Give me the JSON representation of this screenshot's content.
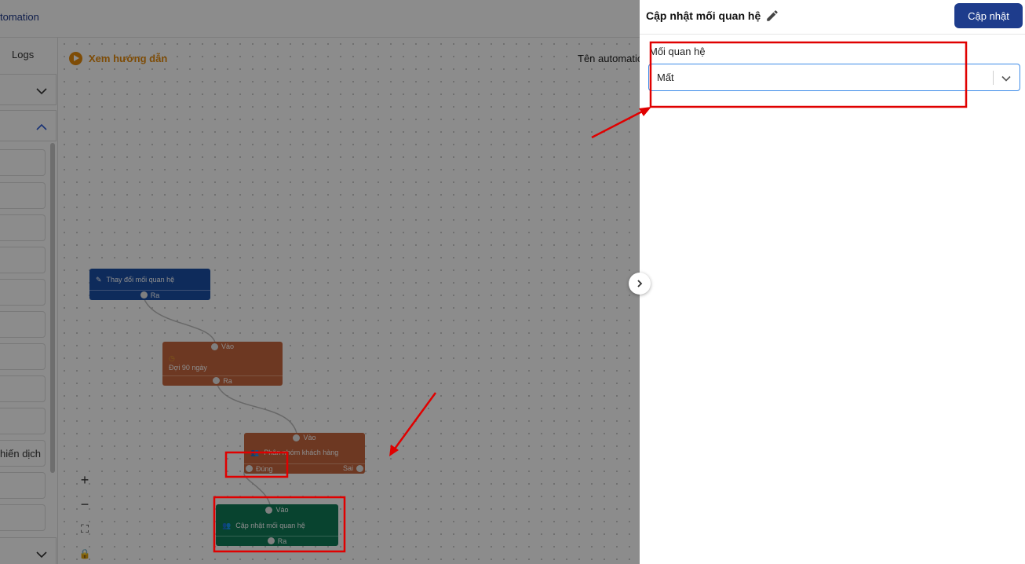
{
  "app": {
    "title_fragment": "tomation"
  },
  "sidebar": {
    "tab_logs": "Logs",
    "field_partial": "hiến dịch"
  },
  "canvas": {
    "guide_label": "Xem hướng dẫn",
    "automation_name_label": "Tên automatio",
    "zoom": {
      "in": "+",
      "out": "−",
      "fit": "⛶",
      "lock": "🔒"
    }
  },
  "flow": {
    "trigger": {
      "label": "Thay đổi mối quan hệ",
      "out": "Ra"
    },
    "wait": {
      "in": "Vào",
      "label": "Đợi 90 ngày",
      "out": "Ra"
    },
    "condition": {
      "in": "Vào",
      "label": "Phân nhóm khách hàng",
      "true_out": "Đúng",
      "false_out": "Sai"
    },
    "action": {
      "in": "Vào",
      "label": "Cập nhật mối quan hệ",
      "out": "Ra"
    }
  },
  "panel": {
    "title": "Cập nhật mối quan hệ",
    "update_button": "Cập nhật",
    "field_label": "Mối quan hệ",
    "field_value": "Mất"
  },
  "colors": {
    "trigger": "#1b4fa6",
    "wait": "#c7663f",
    "condition": "#c7663f",
    "action": "#0f7a57",
    "primary_button": "#1e3c8c",
    "guide": "#e58a0c",
    "annotation": "#e00000"
  }
}
